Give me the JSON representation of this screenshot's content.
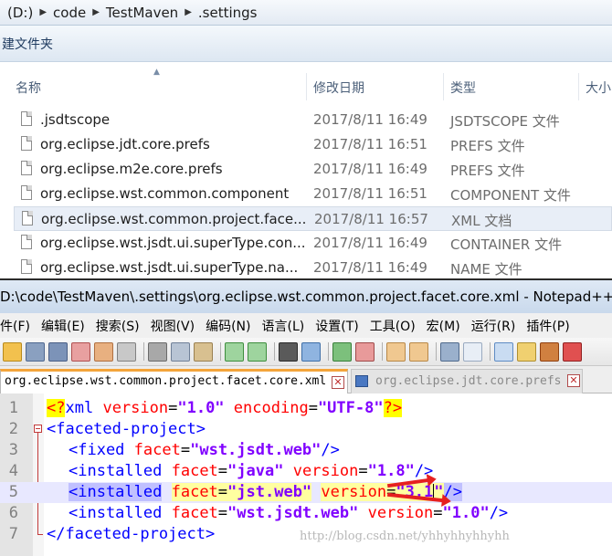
{
  "explorer": {
    "breadcrumb": [
      "(D:)",
      "code",
      "TestMaven",
      ".settings"
    ],
    "new_folder_label": "建文件夹",
    "columns": {
      "name": "名称",
      "modified": "修改日期",
      "type": "类型",
      "size": "大小"
    },
    "files": [
      {
        "name": ".jsdtscope",
        "modified": "2017/8/11 16:49",
        "type": "JSDTSCOPE 文件"
      },
      {
        "name": "org.eclipse.jdt.core.prefs",
        "modified": "2017/8/11 16:51",
        "type": "PREFS 文件"
      },
      {
        "name": "org.eclipse.m2e.core.prefs",
        "modified": "2017/8/11 16:49",
        "type": "PREFS 文件"
      },
      {
        "name": "org.eclipse.wst.common.component",
        "modified": "2017/8/11 16:51",
        "type": "COMPONENT 文件"
      },
      {
        "name": "org.eclipse.wst.common.project.face...",
        "modified": "2017/8/11 16:57",
        "type": "XML 文档"
      },
      {
        "name": "org.eclipse.wst.jsdt.ui.superType.con...",
        "modified": "2017/8/11 16:49",
        "type": "CONTAINER 文件"
      },
      {
        "name": "org.eclipse.wst.jsdt.ui.superType.na...",
        "modified": "2017/8/11 16:49",
        "type": "NAME 文件"
      }
    ]
  },
  "notepad": {
    "title": "D:\\code\\TestMaven\\.settings\\org.eclipse.wst.common.project.facet.core.xml - Notepad++",
    "menu": [
      "件(F)",
      "编辑(E)",
      "搜索(S)",
      "视图(V)",
      "编码(N)",
      "语言(L)",
      "设置(T)",
      "工具(O)",
      "宏(M)",
      "运行(R)",
      "插件(P)"
    ],
    "tabs": [
      {
        "label": "org.eclipse.wst.common.project.facet.core.xml"
      },
      {
        "label": "org.eclipse.jdt.core.prefs"
      }
    ],
    "lines": {
      "l1": {
        "num": "1",
        "pi_open": "<?",
        "name": "xml",
        "a1": "version",
        "v1": "\"1.0\"",
        "a2": "encoding",
        "v2": "\"UTF-8\"",
        "pi_close": "?>"
      },
      "l2": {
        "num": "2",
        "tag": "<faceted-project>"
      },
      "l3": {
        "num": "3",
        "tag": "<fixed",
        "a1": "facet",
        "v1": "\"wst.jsdt.web\"",
        "close": "/>"
      },
      "l4": {
        "num": "4",
        "tag": "<installed",
        "a1": "facet",
        "v1": "\"java\"",
        "a2": "version",
        "v2": "\"1.8\"",
        "close": "/>"
      },
      "l5": {
        "num": "5",
        "tag": "<installed",
        "a1": "facet",
        "v1": "\"jst.web\"",
        "a2": "version",
        "v2_main": "\"3.1",
        "v2_end": "\"",
        "close": "/>"
      },
      "l6": {
        "num": "6",
        "tag": "<installed",
        "a1": "facet",
        "v1": "\"wst.jsdt.web\"",
        "a2": "version",
        "v2": "\"1.0\"",
        "close": "/>"
      },
      "l7": {
        "num": "7",
        "tag": "</faceted-project>"
      }
    }
  },
  "watermark": "http://blog.csdn.net/yhhyhhyhhyhh",
  "colors": {
    "tag": "#0000ff",
    "attribute": "#ff0000",
    "value": "#8000ff",
    "annotation_arrow": "#e62020"
  }
}
